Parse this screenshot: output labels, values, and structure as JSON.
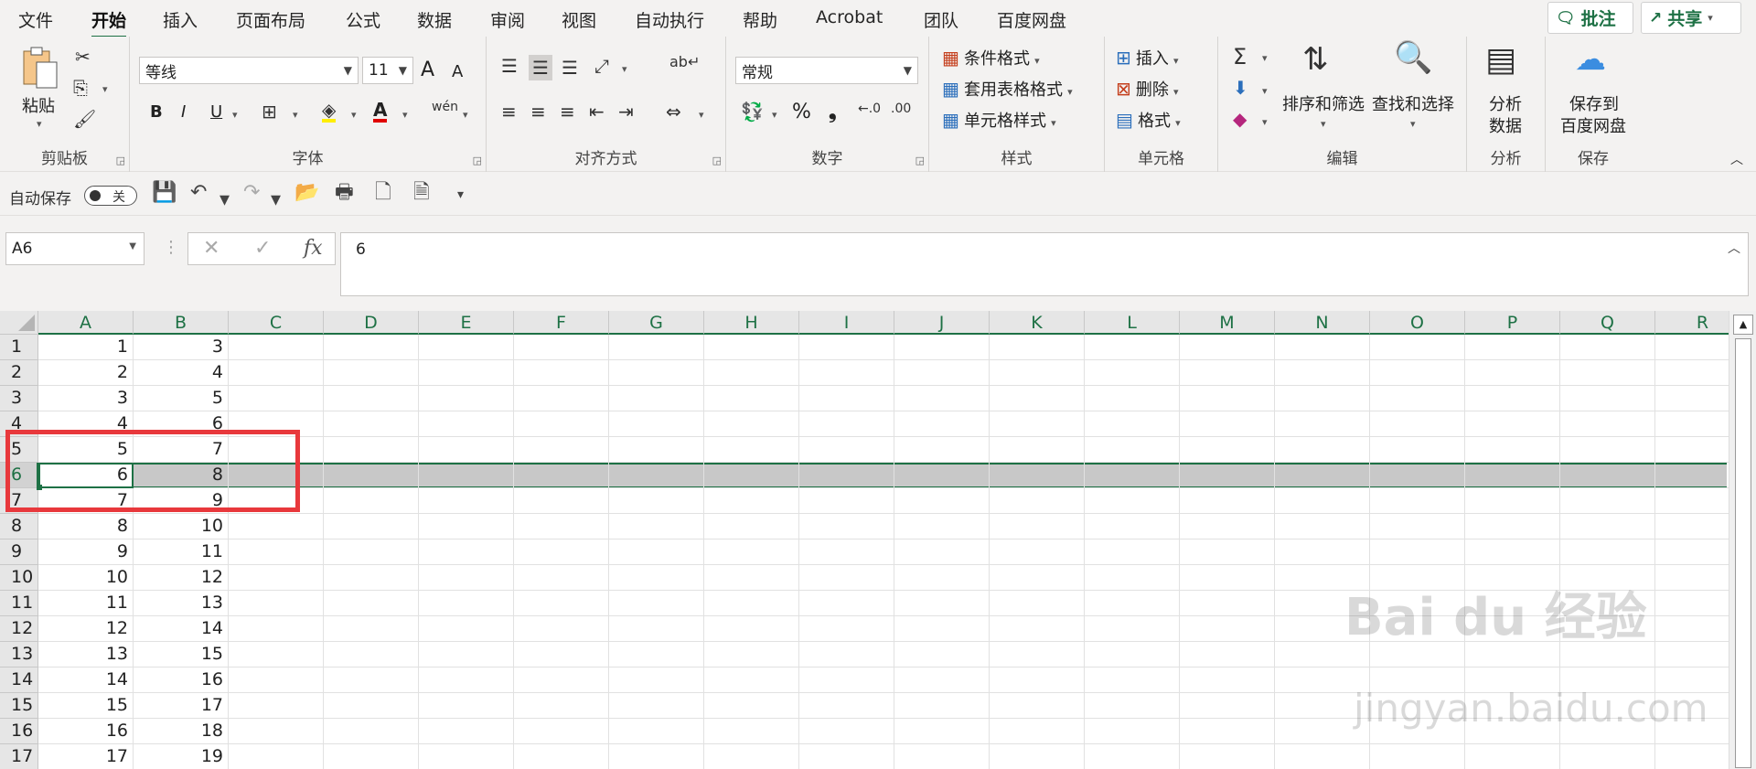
{
  "menu": {
    "tabs": [
      "文件",
      "开始",
      "插入",
      "页面布局",
      "公式",
      "数据",
      "审阅",
      "视图",
      "自动执行",
      "帮助",
      "Acrobat",
      "团队",
      "百度网盘"
    ],
    "comment_btn": "批注",
    "share_btn": "共享"
  },
  "ribbon": {
    "clipboard": {
      "paste": "粘贴",
      "label": "剪贴板"
    },
    "font": {
      "name": "等线",
      "size": "11",
      "bold": "B",
      "italic": "I",
      "underline": "U",
      "grow": "A",
      "shrink": "A",
      "label": "字体"
    },
    "alignment": {
      "label": "对齐方式"
    },
    "number": {
      "format": "常规",
      "percent": "%",
      "comma": "❟",
      "label": "数字"
    },
    "styles": {
      "conditional": "条件格式",
      "table": "套用表格格式",
      "cell": "单元格样式",
      "label": "样式"
    },
    "cells": {
      "insert": "插入",
      "delete": "删除",
      "format": "格式",
      "label": "单元格"
    },
    "editing": {
      "sort_filter": "排序和筛选",
      "find_select": "查找和选择",
      "label": "编辑"
    },
    "analysis": {
      "analyze": "分析",
      "data": "数据",
      "label": "分析"
    },
    "save": {
      "line1": "保存到",
      "line2": "百度网盘",
      "label": "保存"
    }
  },
  "qat": {
    "autosave": "自动保存",
    "toggle": "关"
  },
  "formula_bar": {
    "name_box": "A6",
    "fx": "fx",
    "formula": "6"
  },
  "grid": {
    "columns": [
      "A",
      "B",
      "C",
      "D",
      "E",
      "F",
      "G",
      "H",
      "I",
      "J",
      "K",
      "L",
      "M",
      "N",
      "O",
      "P",
      "Q",
      "R"
    ],
    "rows": [
      {
        "n": "1",
        "a": "1",
        "b": "3"
      },
      {
        "n": "2",
        "a": "2",
        "b": "4"
      },
      {
        "n": "3",
        "a": "3",
        "b": "5"
      },
      {
        "n": "4",
        "a": "4",
        "b": "6"
      },
      {
        "n": "5",
        "a": "5",
        "b": "7"
      },
      {
        "n": "6",
        "a": "6",
        "b": "8"
      },
      {
        "n": "7",
        "a": "7",
        "b": "9"
      },
      {
        "n": "8",
        "a": "8",
        "b": "10"
      },
      {
        "n": "9",
        "a": "9",
        "b": "11"
      },
      {
        "n": "10",
        "a": "10",
        "b": "12"
      },
      {
        "n": "11",
        "a": "11",
        "b": "13"
      },
      {
        "n": "12",
        "a": "12",
        "b": "14"
      },
      {
        "n": "13",
        "a": "13",
        "b": "15"
      },
      {
        "n": "14",
        "a": "14",
        "b": "16"
      },
      {
        "n": "15",
        "a": "15",
        "b": "17"
      },
      {
        "n": "16",
        "a": "16",
        "b": "18"
      },
      {
        "n": "17",
        "a": "17",
        "b": "19"
      }
    ],
    "selected_row": "6"
  },
  "watermark": {
    "main": "Bai du 经验",
    "sub": "jingyan.baidu.com"
  }
}
